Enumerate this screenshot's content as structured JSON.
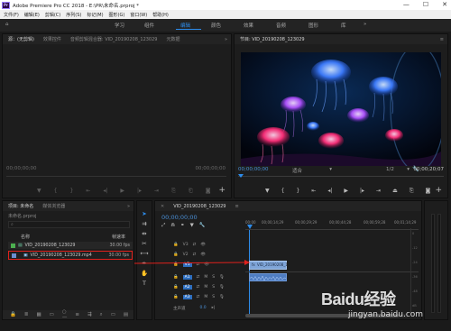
{
  "window": {
    "title": "Adobe Premiere Pro CC 2018 - E:\\PR\\未命名.prproj *",
    "app_badge": "Pr",
    "controls": [
      "—",
      "☐",
      "✕"
    ]
  },
  "menu": [
    "文件(F)",
    "编辑(E)",
    "剪辑(C)",
    "序列(S)",
    "标记(M)",
    "图形(G)",
    "窗口(W)",
    "帮助(H)"
  ],
  "workspaces": {
    "items": [
      "学习",
      "组件",
      "编辑",
      "颜色",
      "效果",
      "音频",
      "图形",
      "库"
    ],
    "active": "编辑",
    "more": "»"
  },
  "source_panel": {
    "tabs": [
      "源：(无剪辑)",
      "效果控件",
      "音频剪辑混合器: VID_20190208_123029",
      "元数据"
    ],
    "timecode_left": "00;00;00;00",
    "timecode_right": "00;00;00;00",
    "more": "»"
  },
  "program_panel": {
    "tab": "节目: VID_20190208_123029",
    "timecode_left": "00;00;00;00",
    "fit": "适合",
    "resolution": "1/2",
    "timecode_right": "00;00;20;07"
  },
  "project_panel": {
    "tabs": [
      "项目: 未命名",
      "媒体浏览器"
    ],
    "more": "»",
    "project_file": "未命名.prproj",
    "columns": [
      "名称",
      "帧速率"
    ],
    "items": [
      {
        "name": "VID_20190208_123029",
        "fps": "30.00 fps",
        "color": "#4caf50"
      },
      {
        "name": "VID_20190208_123029.mp4",
        "fps": "30.00 fps",
        "color": "#6a8fd1"
      }
    ]
  },
  "timeline": {
    "tab": "VID_20190208_123029",
    "timecode": "00;00;00;00",
    "ruler": [
      "00;00",
      "00;00;14;29",
      "00;00;29;29",
      "00;00;44;28",
      "00;00;59;28",
      "00;01;14;29"
    ],
    "video_tracks": [
      "V3",
      "V2",
      "V1"
    ],
    "audio_tracks": [
      "A1",
      "A2",
      "A3"
    ],
    "master": "主声道",
    "master_value": "0.0",
    "clip_label": "VID_20190208_1",
    "clip_icon": "fx",
    "track_toggles": [
      "M",
      "S"
    ],
    "level_labels": [
      "0",
      "-12",
      "-24",
      "-36",
      "-48",
      "dB"
    ]
  },
  "tools": [
    "selection",
    "track-select",
    "ripple",
    "razor",
    "slip",
    "pen",
    "hand",
    "type"
  ],
  "watermark": {
    "brand": "Baidu经验",
    "url": "jingyan.baidu.com"
  },
  "colors": {
    "accent_blue": "#2d8ceb",
    "timecode_blue": "#4a8fd6",
    "highlight_red": "#e0211c",
    "clip_audio": "#4f7dc2",
    "clip_video": "#7fa5d8"
  }
}
